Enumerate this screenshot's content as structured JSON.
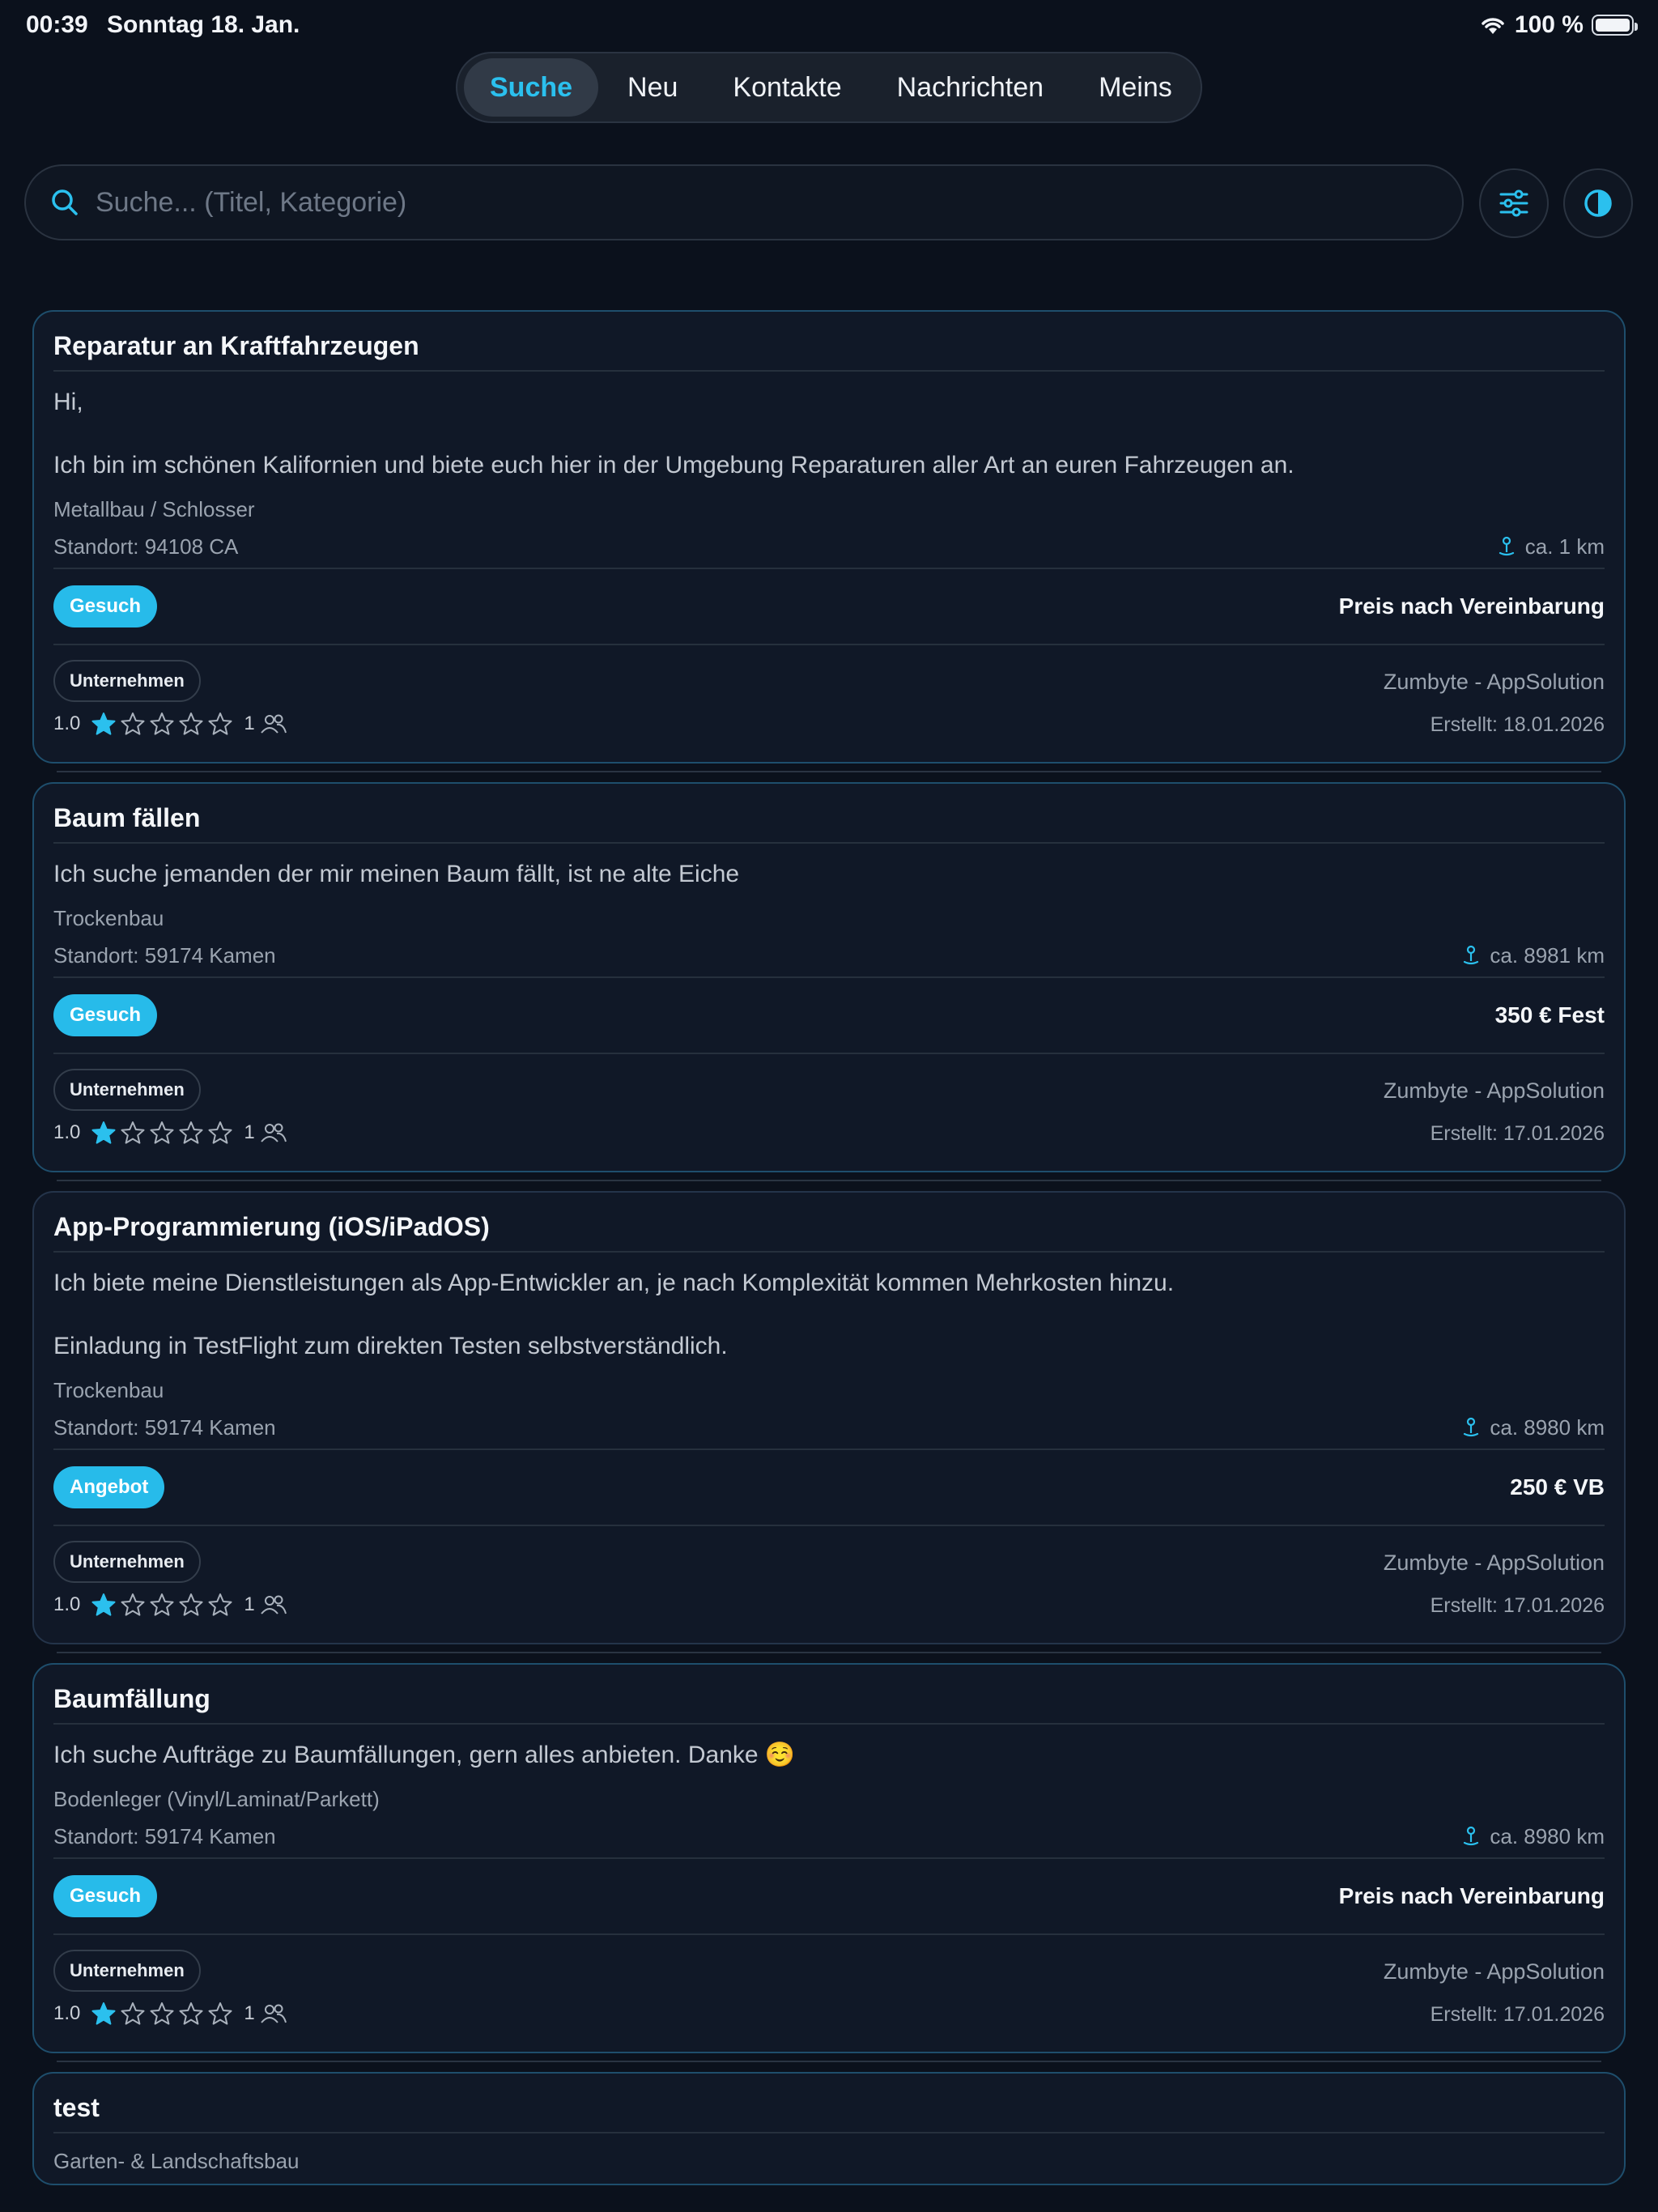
{
  "status_bar": {
    "time": "00:39",
    "date": "Sonntag 18. Jan.",
    "battery": "100 %"
  },
  "tabs": [
    {
      "label": "Suche",
      "active": true
    },
    {
      "label": "Neu",
      "active": false
    },
    {
      "label": "Kontakte",
      "active": false
    },
    {
      "label": "Nachrichten",
      "active": false
    },
    {
      "label": "Meins",
      "active": false
    }
  ],
  "search": {
    "placeholder": "Suche... (Titel, Kategorie)",
    "value": ""
  },
  "colors": {
    "accent": "#27bbea",
    "background": "#0b111c",
    "card": "#101827"
  },
  "cards": [
    {
      "title": "Reparatur an Kraftfahrzeugen",
      "description": [
        "Hi,",
        "Ich bin im schönen Kalifornien und biete euch hier in der Umgebung Reparaturen aller Art an euren Fahrzeugen an."
      ],
      "category": "Metallbau / Schlosser",
      "location": "Standort: 94108 CA",
      "distance": "ca. 1 km",
      "type": "Gesuch",
      "price": "Preis nach Vereinbarung",
      "badge": "Unternehmen",
      "seller": "Zumbyte - AppSolution",
      "rating": "1.0",
      "rating_stars": 1,
      "reviews": "1",
      "created": "Erstellt: 18.01.2026"
    },
    {
      "title": "Baum fällen",
      "description": [
        "Ich suche jemanden der mir meinen Baum fällt, ist ne alte Eiche"
      ],
      "category": "Trockenbau",
      "location": "Standort: 59174 Kamen",
      "distance": "ca. 8981 km",
      "type": "Gesuch",
      "price": "350 € Fest",
      "badge": "Unternehmen",
      "seller": "Zumbyte - AppSolution",
      "rating": "1.0",
      "rating_stars": 1,
      "reviews": "1",
      "created": "Erstellt: 17.01.2026"
    },
    {
      "title": "App-Programmierung (iOS/iPadOS)",
      "description": [
        "Ich biete meine Dienstleistungen als App-Entwickler an, je nach Komplexität kommen Mehrkosten hinzu.",
        "Einladung in TestFlight zum direkten Testen selbstverständlich."
      ],
      "category": "Trockenbau",
      "location": "Standort: 59174 Kamen",
      "distance": "ca. 8980 km",
      "type": "Angebot",
      "price": "250 € VB",
      "badge": "Unternehmen",
      "seller": "Zumbyte - AppSolution",
      "rating": "1.0",
      "rating_stars": 1,
      "reviews": "1",
      "created": "Erstellt: 17.01.2026"
    },
    {
      "title": "Baumfällung",
      "description": [
        "Ich suche Aufträge zu Baumfällungen, gern alles anbieten. Danke ☺️"
      ],
      "category": "Bodenleger (Vinyl/Laminat/Parkett)",
      "location": "Standort: 59174 Kamen",
      "distance": "ca. 8980 km",
      "type": "Gesuch",
      "price": "Preis nach Vereinbarung",
      "badge": "Unternehmen",
      "seller": "Zumbyte - AppSolution",
      "rating": "1.0",
      "rating_stars": 1,
      "reviews": "1",
      "created": "Erstellt: 17.01.2026"
    }
  ],
  "partial_card": {
    "title": "test",
    "category": "Garten- & Landschaftsbau"
  },
  "icons": {
    "search": "search-icon",
    "filter": "sliders-icon",
    "theme": "contrast-icon",
    "distance": "location-pin-icon",
    "reviews": "people-icon",
    "star_filled": "star-filled-icon",
    "star_empty": "star-outline-icon"
  }
}
